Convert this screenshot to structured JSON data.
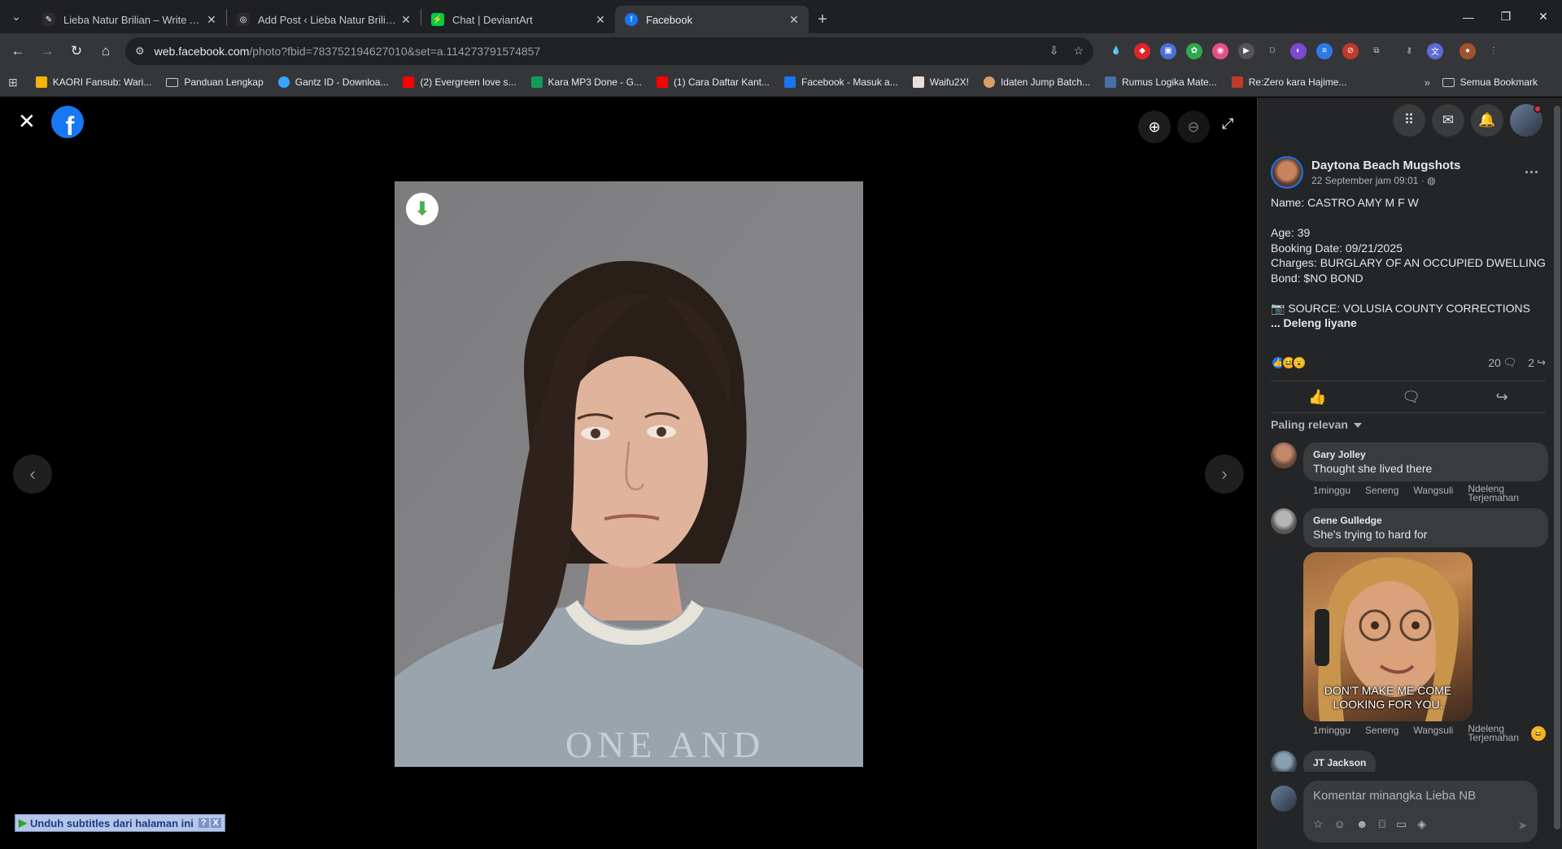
{
  "browser": {
    "tabs": [
      {
        "title": "Lieba Natur Brilian – Write Anyt",
        "favicon_color": "#2b2b2b",
        "active": false
      },
      {
        "title": "Add Post ‹ Lieba Natur Brilian —",
        "favicon_color": "#2b2b2b",
        "active": false
      },
      {
        "title": "Chat | DeviantArt",
        "favicon_color": "#05cc47",
        "active": false
      },
      {
        "title": "Facebook",
        "favicon_color": "#1877f2",
        "active": true
      }
    ],
    "url_host": "web.facebook.com",
    "url_path": "/photo?fbid=783752194627010&set=a.114273791574857",
    "bookmarks": [
      {
        "label": "KAORI Fansub: Wari...",
        "color": "#f4b400"
      },
      {
        "label": "Panduan Lengkap",
        "color": "folder"
      },
      {
        "label": "Gantz ID - Downloa...",
        "color": "#34a8ff"
      },
      {
        "label": "(2) Evergreen love s...",
        "color": "#ff0000"
      },
      {
        "label": "Kara MP3 Done - G...",
        "color": "#0f9d58"
      },
      {
        "label": "(1) Cara Daftar Kant...",
        "color": "#ff0000"
      },
      {
        "label": "Facebook - Masuk a...",
        "color": "#1877f2"
      },
      {
        "label": "Waifu2X!",
        "color": "#e8e0d8"
      },
      {
        "label": "Idaten Jump Batch...",
        "color": "#d9a066"
      },
      {
        "label": "Rumus Logika Mate...",
        "color": "#4a6fa5"
      },
      {
        "label": "Re:Zero kara Hajime...",
        "color": "#c0392b"
      }
    ],
    "bookmarks_all": "Semua Bookmark"
  },
  "viewer": {
    "photo_download_icon": "download-arrow-icon",
    "subtitle_bar": "Unduh subtitles dari halaman ini"
  },
  "post": {
    "page_name": "Daytona Beach Mugshots",
    "timestamp": "22 September jam 09:01 ·",
    "body_lines": "Name: CASTRO AMY M F W\n\nAge: 39\nBooking Date: 09/21/2025\nCharges: BURGLARY OF AN OCCUPIED DWELLING\nBond: $NO BOND\n\n📷 SOURCE: VOLUSIA COUNTY CORRECTIONS",
    "see_more": "... Deleng liyane",
    "comment_count": "20",
    "share_count": "2",
    "sort_label": "Paling relevan"
  },
  "comments": [
    {
      "name": "Gary Jolley",
      "text": "Thought she lived there",
      "time": "1minggu",
      "like": "Seneng",
      "reply": "Wangsuli",
      "translate_1": "Ndeleng",
      "translate_2": "Terjemahan"
    },
    {
      "name": "Gene Gulledge",
      "text": "She's trying to hard for",
      "time": "1minggu",
      "like": "Seneng",
      "reply": "Wangsuli",
      "translate_1": "Ndeleng",
      "translate_2": "Terjemahan",
      "gif_caption_1": "DON'T MAKE ME COME",
      "gif_caption_2": "LOOKING FOR YOU."
    },
    {
      "name": "JT Jackson"
    }
  ],
  "composer": {
    "placeholder": "Komentar minangka Lieba NB"
  },
  "colors": {
    "fb_blue": "#1877f2",
    "panel_bg": "#242526",
    "bubble_bg": "#3a3b3c"
  }
}
